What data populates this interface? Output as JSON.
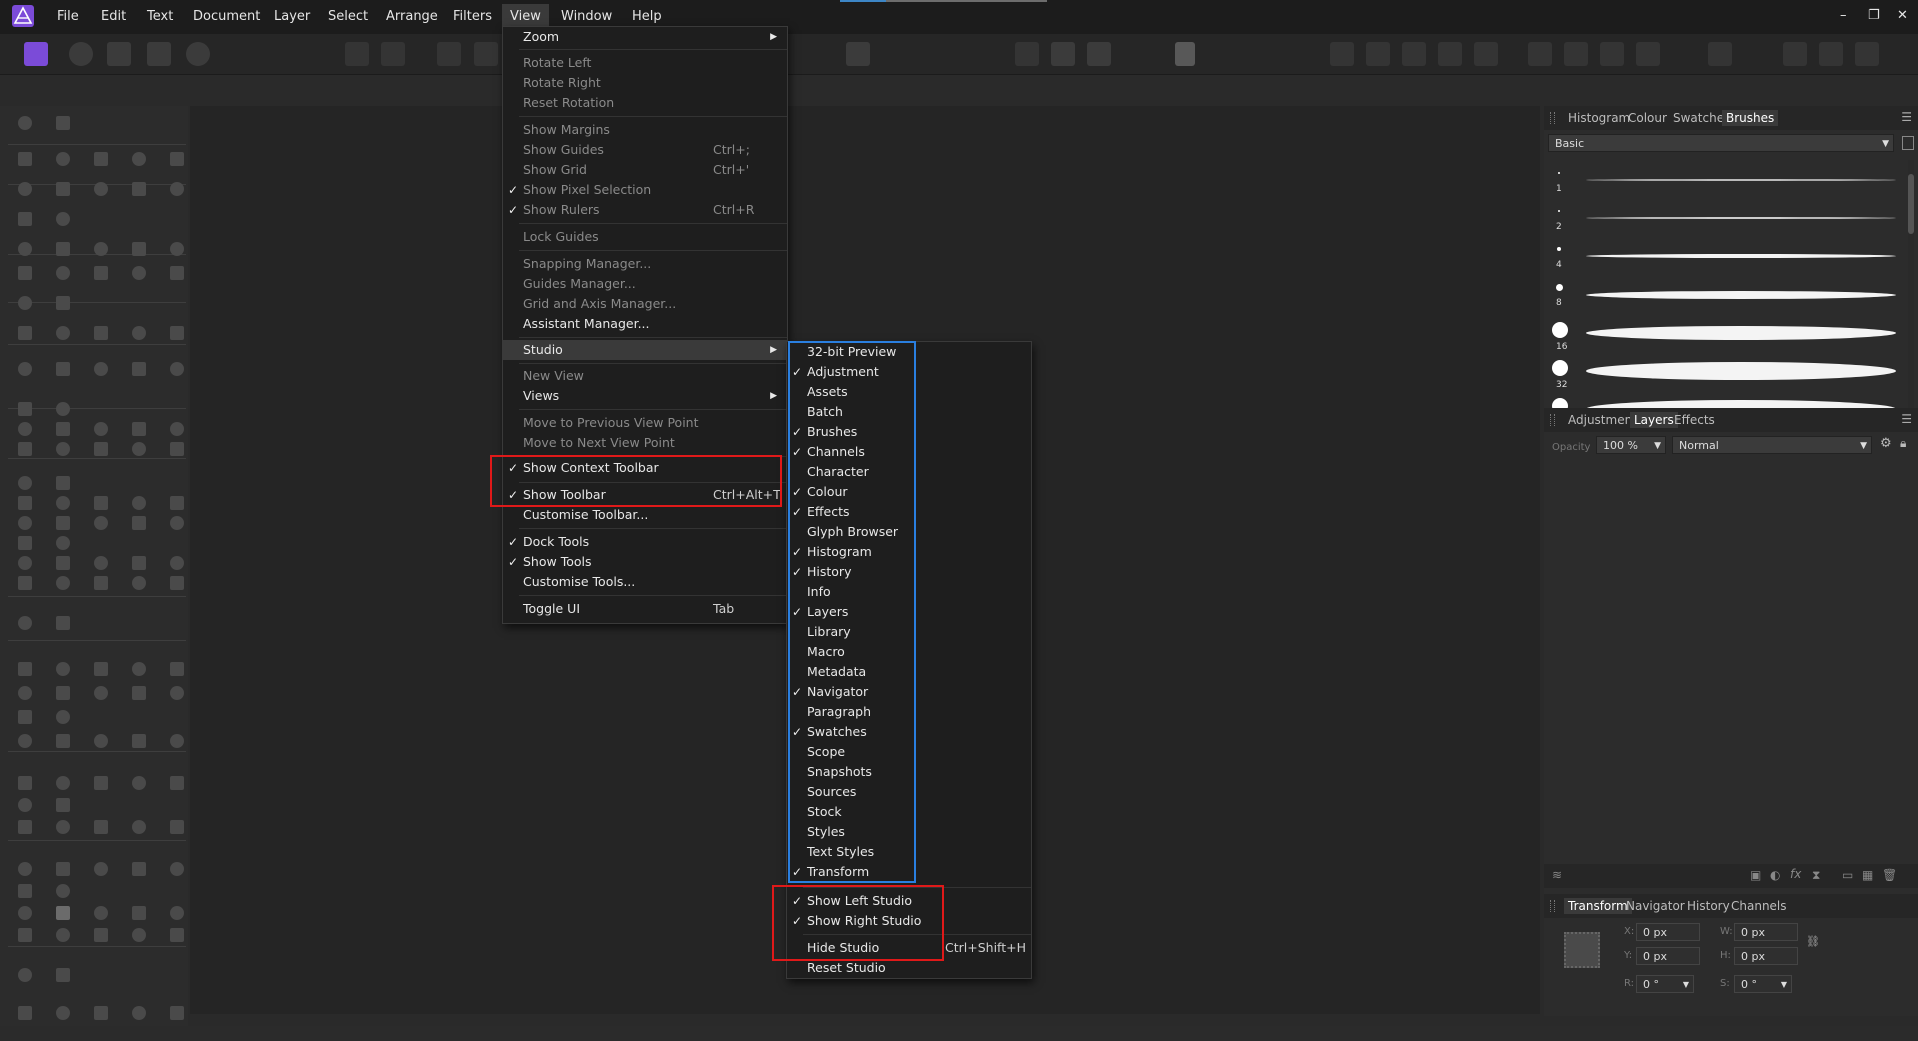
{
  "menubar": {
    "items": [
      "File",
      "Edit",
      "Text",
      "Document",
      "Layer",
      "Select",
      "Arrange",
      "Filters",
      "View",
      "Window",
      "Help"
    ],
    "active": "View",
    "window_controls": [
      "–",
      "❐",
      "✕"
    ]
  },
  "view_menu": {
    "zoom": "Zoom",
    "rotate_left": "Rotate Left",
    "rotate_right": "Rotate Right",
    "reset_rotation": "Reset Rotation",
    "show_margins": "Show Margins",
    "show_guides": "Show Guides",
    "show_guides_sc": "Ctrl+;",
    "show_grid": "Show Grid",
    "show_grid_sc": "Ctrl+'",
    "show_pixel_selection": "Show Pixel Selection",
    "show_rulers": "Show Rulers",
    "show_rulers_sc": "Ctrl+R",
    "lock_guides": "Lock Guides",
    "snapping_manager": "Snapping Manager...",
    "guides_manager": "Guides Manager...",
    "grid_axis_manager": "Grid and Axis Manager...",
    "assistant_manager": "Assistant Manager...",
    "studio": "Studio",
    "new_view": "New View",
    "views": "Views",
    "move_prev": "Move to Previous View Point",
    "move_next": "Move to Next View Point",
    "show_context_toolbar": "Show Context Toolbar",
    "show_toolbar": "Show Toolbar",
    "show_toolbar_sc": "Ctrl+Alt+T",
    "customise_toolbar": "Customise Toolbar...",
    "dock_tools": "Dock Tools",
    "show_tools": "Show Tools",
    "customise_tools": "Customise Tools...",
    "toggle_ui": "Toggle UI",
    "toggle_ui_sc": "Tab",
    "check": "✓"
  },
  "studio_menu": {
    "panels": [
      {
        "label": "32-bit Preview",
        "checked": false
      },
      {
        "label": "Adjustment",
        "checked": true
      },
      {
        "label": "Assets",
        "checked": false
      },
      {
        "label": "Batch",
        "checked": false
      },
      {
        "label": "Brushes",
        "checked": true
      },
      {
        "label": "Channels",
        "checked": true
      },
      {
        "label": "Character",
        "checked": false
      },
      {
        "label": "Colour",
        "checked": true
      },
      {
        "label": "Effects",
        "checked": true
      },
      {
        "label": "Glyph Browser",
        "checked": false
      },
      {
        "label": "Histogram",
        "checked": true
      },
      {
        "label": "History",
        "checked": true
      },
      {
        "label": "Info",
        "checked": false
      },
      {
        "label": "Layers",
        "checked": true
      },
      {
        "label": "Library",
        "checked": false
      },
      {
        "label": "Macro",
        "checked": false
      },
      {
        "label": "Metadata",
        "checked": false
      },
      {
        "label": "Navigator",
        "checked": true
      },
      {
        "label": "Paragraph",
        "checked": false
      },
      {
        "label": "Swatches",
        "checked": true
      },
      {
        "label": "Scope",
        "checked": false
      },
      {
        "label": "Snapshots",
        "checked": false
      },
      {
        "label": "Sources",
        "checked": false
      },
      {
        "label": "Stock",
        "checked": false
      },
      {
        "label": "Styles",
        "checked": false
      },
      {
        "label": "Text Styles",
        "checked": false
      },
      {
        "label": "Transform",
        "checked": true
      }
    ],
    "show_left_studio": "Show Left Studio",
    "show_right_studio": "Show Right Studio",
    "hide_studio": "Hide Studio",
    "hide_studio_sc": "Ctrl+Shift+H",
    "reset_studio": "Reset Studio"
  },
  "top_panel": {
    "tabs": [
      "Histogram",
      "Colour",
      "Swatches",
      "Brushes"
    ],
    "active": "Brushes",
    "category": "Basic",
    "brush_sizes": [
      "1",
      "2",
      "4",
      "8",
      "16",
      "32"
    ]
  },
  "mid_panel": {
    "tabs": [
      "Adjustment",
      "Layers",
      "Effects"
    ],
    "active": "Layers",
    "opacity_label": "Opacity",
    "opacity": "100 %",
    "blend_mode": "Normal"
  },
  "bottom_panel": {
    "tabs": [
      "Transform",
      "Navigator",
      "History",
      "Channels"
    ],
    "active": "Transform",
    "x_label": "X:",
    "x": "0 px",
    "y_label": "Y:",
    "y": "0 px",
    "w_label": "W:",
    "w": "0 px",
    "h_label": "H:",
    "h": "0 px",
    "r_label": "R:",
    "r": "0 °",
    "s_label": "S:",
    "s": "0 °"
  },
  "colors": {
    "annotation_red": "#e01919",
    "annotation_blue": "#2a7fe0",
    "logo": "#7b4bd8"
  }
}
